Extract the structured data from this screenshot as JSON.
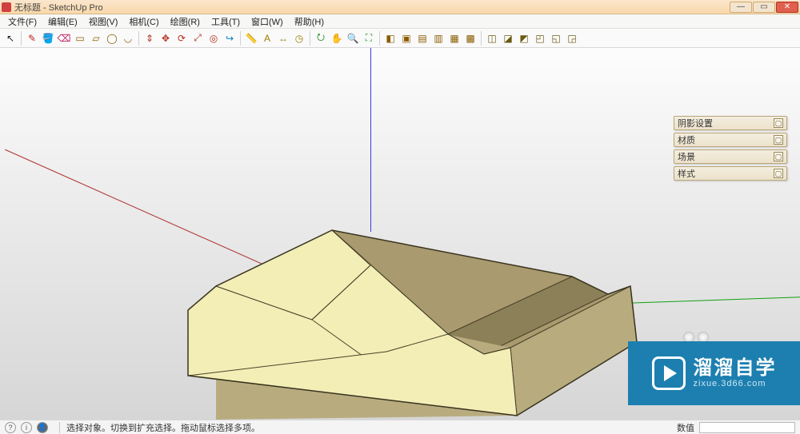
{
  "title": "无标题 - SketchUp Pro",
  "menu": [
    "文件(F)",
    "编辑(E)",
    "视图(V)",
    "相机(C)",
    "绘图(R)",
    "工具(T)",
    "窗口(W)",
    "帮助(H)"
  ],
  "toolbar_groups": [
    [
      "select"
    ],
    [
      "pencil",
      "paint",
      "eraser",
      "rect",
      "rect2",
      "circle",
      "arc"
    ],
    [
      "pushpull",
      "move",
      "rotate",
      "scale",
      "offset",
      "followme"
    ],
    [
      "tape",
      "text",
      "dim",
      "protractor"
    ],
    [
      "orbit",
      "pan",
      "zoom",
      "zoom-extents"
    ],
    [
      "iso",
      "front",
      "back",
      "left",
      "right",
      "top"
    ],
    [
      "style1",
      "style2",
      "style3",
      "style4",
      "style5",
      "style6"
    ]
  ],
  "toolbar_icons": {
    "select": "↖",
    "pencil": "✎",
    "paint": "🪣",
    "eraser": "⌫",
    "rect": "▭",
    "rect2": "▱",
    "circle": "◯",
    "arc": "◡",
    "pushpull": "⇕",
    "move": "✥",
    "rotate": "⟳",
    "scale": "⤢",
    "offset": "◎",
    "followme": "↪",
    "tape": "📏",
    "text": "A",
    "dim": "↔",
    "protractor": "◷",
    "orbit": "⭮",
    "pan": "✋",
    "zoom": "🔍",
    "zoom-extents": "⛶",
    "iso": "◧",
    "front": "▣",
    "back": "▤",
    "left": "▥",
    "right": "▦",
    "top": "▩",
    "style1": "◫",
    "style2": "◪",
    "style3": "◩",
    "style4": "◰",
    "style5": "◱",
    "style6": "◲"
  },
  "toolbar_colors": {
    "select": "#202020",
    "pencil": "#c02020",
    "paint": "#c06a20",
    "eraser": "#c02060",
    "rect": "#8a5c00",
    "rect2": "#8a5c00",
    "circle": "#8a5c00",
    "arc": "#8a5c00",
    "pushpull": "#b03020",
    "move": "#b03020",
    "rotate": "#b03020",
    "scale": "#b03020",
    "offset": "#b03020",
    "followme": "#0080c0",
    "tape": "#9a8000",
    "text": "#9a8000",
    "dim": "#9a8000",
    "protractor": "#9a8000",
    "orbit": "#209020",
    "pan": "#209020",
    "zoom": "#209020",
    "zoom-extents": "#209020",
    "iso": "#8a5c00",
    "front": "#8a5c00",
    "back": "#8a5c00",
    "left": "#8a5c00",
    "right": "#8a5c00",
    "top": "#8a5c00",
    "style1": "#6a5a10",
    "style2": "#6a5a10",
    "style3": "#6a5a10",
    "style4": "#6a5a10",
    "style5": "#6a5a10",
    "style6": "#6a5a10"
  },
  "panels": [
    "阴影设置",
    "材质",
    "场景",
    "样式"
  ],
  "status": {
    "hint": "选择对象。切换到扩充选择。拖动鼠标选择多项。",
    "value_label": "数值"
  },
  "watermark": {
    "big": "溜溜自学",
    "small": "zixue.3d66.com"
  }
}
